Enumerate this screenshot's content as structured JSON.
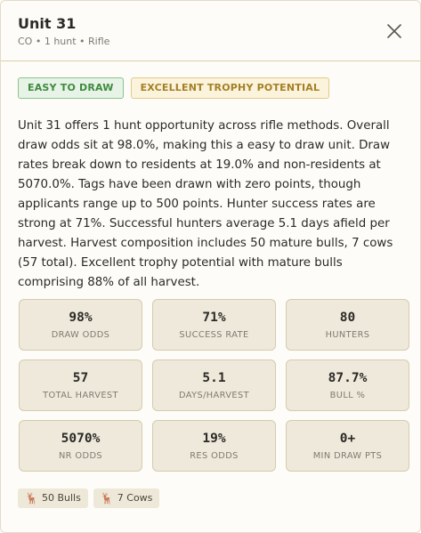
{
  "header": {
    "title": "Unit 31",
    "subtitle": "CO • 1 hunt • Rifle"
  },
  "badges": [
    {
      "label": "EASY TO DRAW",
      "color": "#3f8a3f"
    },
    {
      "label": "EXCELLENT TROPHY POTENTIAL",
      "color": "#a48024"
    }
  ],
  "description": "Unit 31 offers 1 hunt opportunity across rifle methods. Overall draw odds sit at 98.0%, making this a easy to draw unit. Draw rates break down to residents at 19.0% and non-residents at 5070.0%. Tags have been drawn with zero points, though applicants range up to 500 points. Hunter success rates are strong at 71%. Successful hunters average 5.1 days afield per harvest. Harvest composition includes 50 mature bulls, 7 cows (57 total). Excellent trophy potential with mature bulls comprising 88% of all harvest.",
  "stats": [
    {
      "value": "98%",
      "label": "DRAW ODDS"
    },
    {
      "value": "71%",
      "label": "SUCCESS RATE"
    },
    {
      "value": "80",
      "label": "HUNTERS"
    },
    {
      "value": "57",
      "label": "TOTAL HARVEST"
    },
    {
      "value": "5.1",
      "label": "DAYS/HARVEST"
    },
    {
      "value": "87.7%",
      "label": "BULL %"
    },
    {
      "value": "5070%",
      "label": "NR ODDS"
    },
    {
      "value": "19%",
      "label": "RES ODDS"
    },
    {
      "value": "0+",
      "label": "MIN DRAW PTS"
    }
  ],
  "tags": [
    {
      "icon": "elk-icon",
      "glyph": "🦌",
      "label": "50 Bulls"
    },
    {
      "icon": "elk-icon",
      "glyph": "🦌",
      "label": "7 Cows"
    }
  ]
}
